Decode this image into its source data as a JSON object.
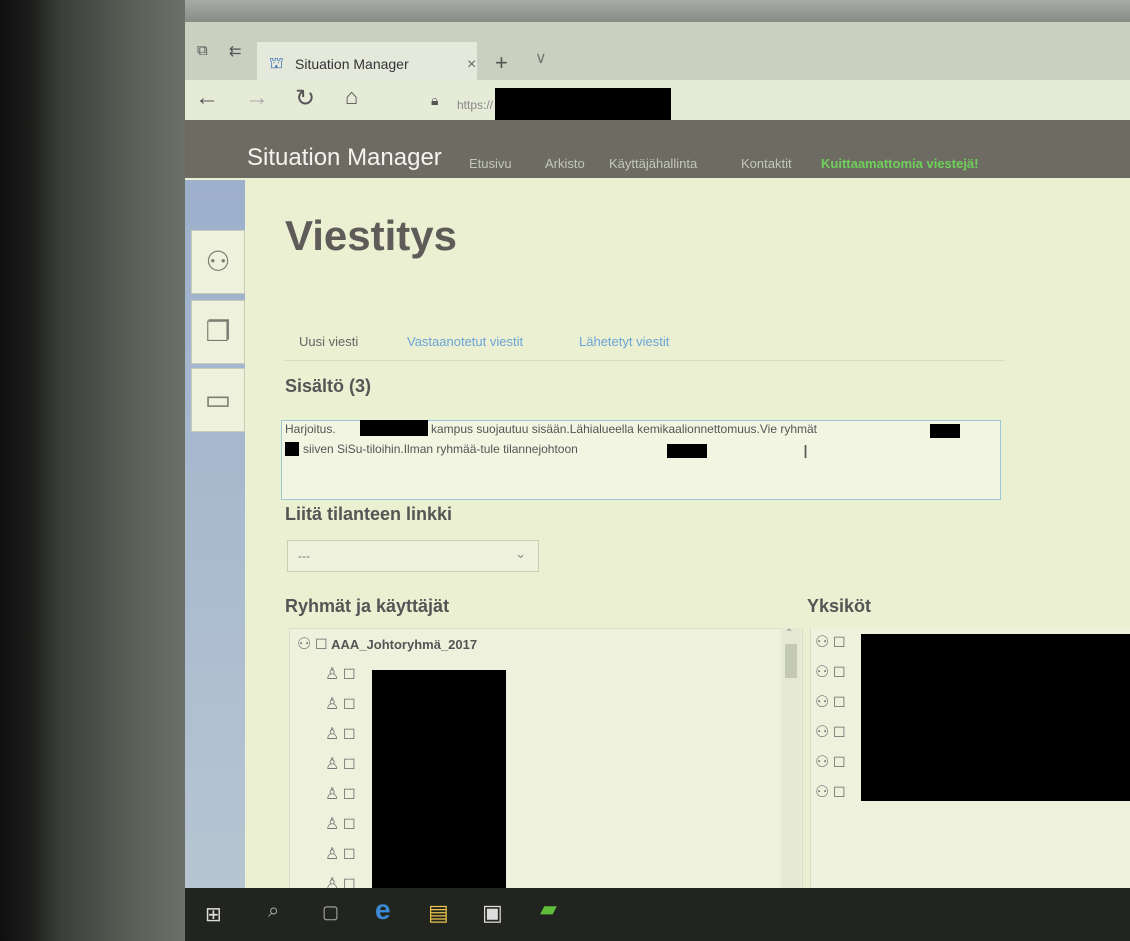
{
  "browser": {
    "tab_title": "Situation Manager",
    "url_text": "https://",
    "new_tab_glyph": "+",
    "tab_close_glyph": "×",
    "tab_menu_glyph": "∨"
  },
  "app": {
    "brand": "Situation Manager",
    "menu": [
      "Etusivu",
      "Arkisto",
      "Käyttäjähallinta",
      "Kontaktit"
    ],
    "alert": "Kuittaamattomia viestejä!"
  },
  "page": {
    "title": "Viestitys",
    "tabs": [
      {
        "label": "Uusi viesti",
        "active": true
      },
      {
        "label": "Vastaanotetut viestit",
        "active": false
      },
      {
        "label": "Lähetetyt viestit",
        "active": false
      }
    ]
  },
  "content": {
    "heading": "Sisältö (3)",
    "line1_a": "Harjoitus.",
    "line1_b": "kampus suojautuu sisään.Lähialueella kemikaalionnettomuus.Vie ryhmät",
    "line2_a": "siiven SiSu-tiloihin.Ilman ryhmää-tule tilannejohtoon"
  },
  "link_section": {
    "heading": "Liitä tilanteen linkki",
    "select_value": "---"
  },
  "groups": {
    "heading": "Ryhmät ja käyttäjät",
    "group_name": "AAA_Johtoryhmä_2017",
    "user_rows": 8
  },
  "units": {
    "heading": "Yksiköt",
    "rows": 6
  },
  "icons": {
    "user": "user-icon",
    "group": "group-icon",
    "checkbox": "checkbox-icon",
    "documents": "documents-icon",
    "chat": "chat-icon"
  }
}
